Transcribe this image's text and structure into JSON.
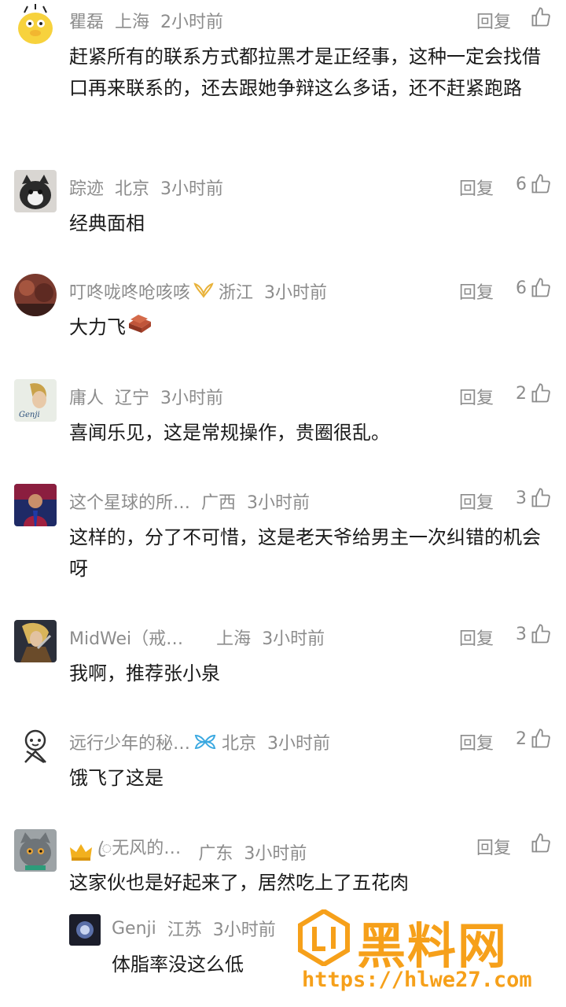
{
  "reply_label": "回复",
  "comments": [
    {
      "user": "瞿磊",
      "location": "上海",
      "time": "2小时前",
      "likes": "",
      "text": "赶紧所有的联系方式都拉黑才是正经事，这种一定会找借口再来联系的，还去跟她争辩这么多话，还不赶紧跑路"
    },
    {
      "user": "踪迹",
      "location": "北京",
      "time": "3小时前",
      "likes": "6",
      "text": "经典面相"
    },
    {
      "user": "叮咚咙咚呛咳咳",
      "location": "浙江",
      "time": "3小时前",
      "likes": "6",
      "text": "大力飞",
      "badge": "gold-wings-badge",
      "emoji": "brick-emoji"
    },
    {
      "user": "庸人",
      "location": "辽宁",
      "time": "3小时前",
      "likes": "2",
      "text": "喜闻乐见，这是常规操作，贵圈很乱。"
    },
    {
      "user": "这个星球的所…",
      "location": "广西",
      "time": "3小时前",
      "likes": "3",
      "text": "这样的，分了不可惜，这是老天爷给男主一次纠错的机会呀"
    },
    {
      "user": "MidWei（戒…",
      "location": "上海",
      "time": "3小时前",
      "likes": "3",
      "text": "我啊，推荐张小泉"
    },
    {
      "user": "远行少年的秘…",
      "location": "北京",
      "time": "3小时前",
      "likes": "2",
      "text": "饿飞了这是",
      "badge": "blue-wings-badge"
    },
    {
      "user": "ꦿ无风的…",
      "location": "广东",
      "time": "3小时前",
      "likes": "",
      "text": "这家伙也是好起来了，居然吃上了五花肉",
      "badge": "crown-badge"
    }
  ],
  "sub_reply": {
    "user": "Genji",
    "location": "江苏",
    "time": "3小时前",
    "text": "体脂率没这么低"
  },
  "watermark": {
    "title": "黑料网",
    "url": "https://hlwe27.com"
  },
  "colors": {
    "meta_gray": "#8c8c8c",
    "text": "#1a1a1a",
    "watermark": "#f6a01a"
  }
}
